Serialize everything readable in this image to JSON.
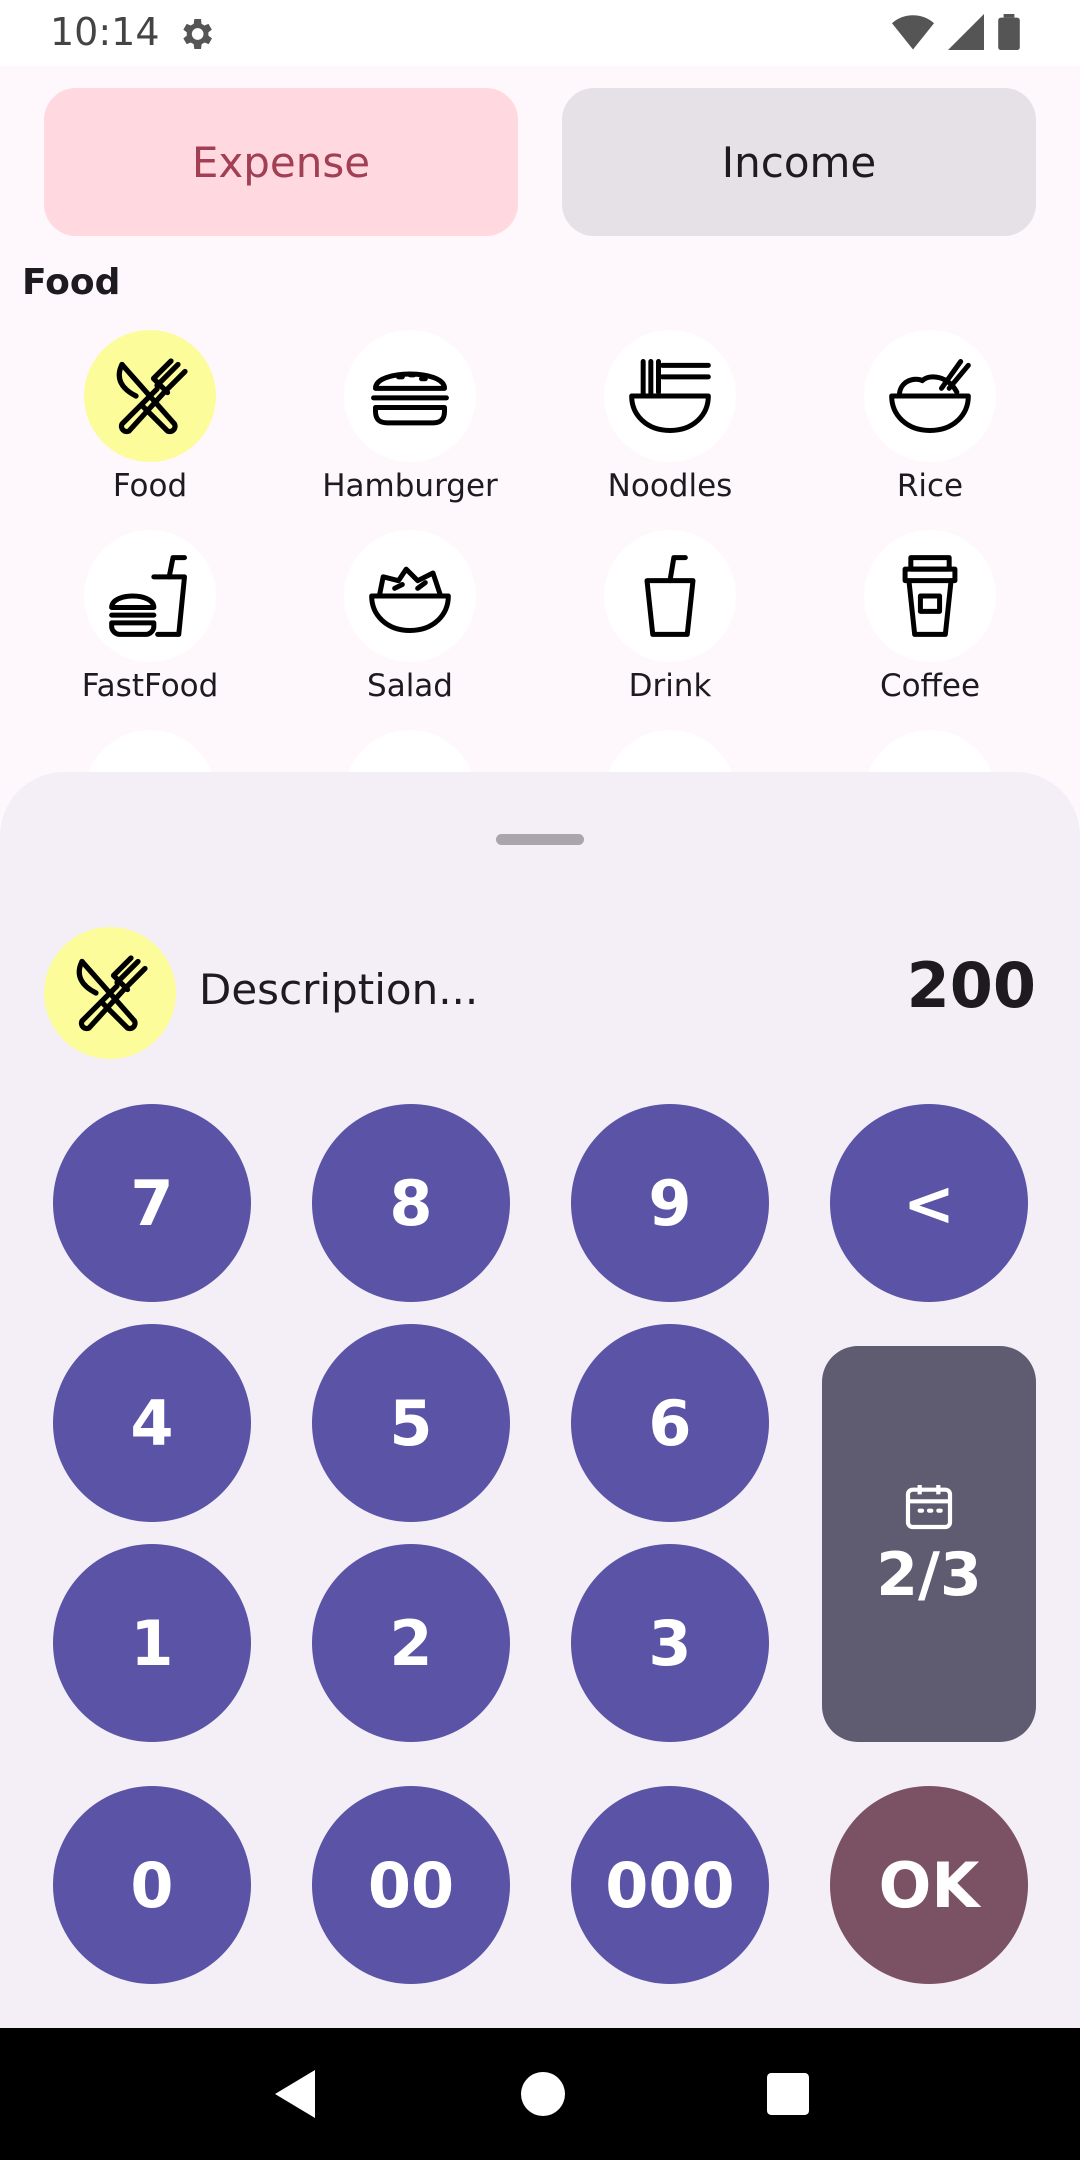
{
  "status": {
    "time": "10:14"
  },
  "type_toggle": {
    "expense_label": "Expense",
    "income_label": "Income",
    "selected": "expense"
  },
  "section": {
    "title": "Food"
  },
  "categories": [
    {
      "label": "Food",
      "icon": "fork-knife-icon",
      "selected": true
    },
    {
      "label": "Hamburger",
      "icon": "hamburger-icon"
    },
    {
      "label": "Noodles",
      "icon": "noodles-icon"
    },
    {
      "label": "Rice",
      "icon": "rice-bowl-icon"
    },
    {
      "label": "FastFood",
      "icon": "fastfood-icon"
    },
    {
      "label": "Salad",
      "icon": "salad-icon"
    },
    {
      "label": "Drink",
      "icon": "drink-icon"
    },
    {
      "label": "Coffee",
      "icon": "coffee-icon"
    }
  ],
  "entry": {
    "description_placeholder": "Description...",
    "amount": "200",
    "icon": "fork-knife-icon"
  },
  "keypad": {
    "k7": "7",
    "k8": "8",
    "k9": "9",
    "back": "<",
    "k4": "4",
    "k5": "5",
    "k6": "6",
    "k1": "1",
    "k2": "2",
    "k3": "3",
    "k0": "0",
    "k00": "00",
    "k000": "000",
    "ok": "OK",
    "date": "2/3"
  },
  "colors": {
    "accent": "#5a53a6",
    "ok": "#7b5264",
    "date_key": "#5f5c72",
    "selected_icon_bg": "#fcfc9a",
    "expense_bg": "#ffd9df"
  }
}
